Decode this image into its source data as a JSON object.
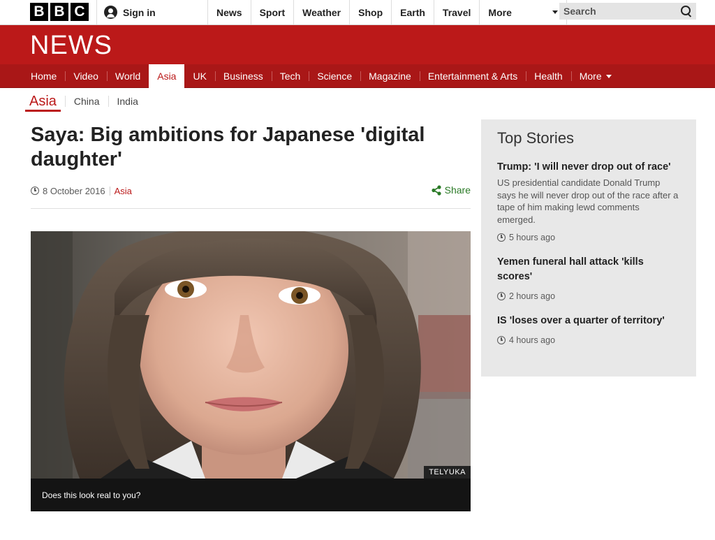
{
  "masthead": {
    "logo_letters": [
      "B",
      "B",
      "C"
    ],
    "signin_label": "Sign in",
    "nav": [
      "News",
      "Sport",
      "Weather",
      "Shop",
      "Earth",
      "Travel"
    ],
    "more_label": "More",
    "search_placeholder": "Search"
  },
  "banner": {
    "title": "NEWS"
  },
  "section_nav": {
    "items": [
      "Home",
      "Video",
      "World",
      "Asia",
      "UK",
      "Business",
      "Tech",
      "Science",
      "Magazine",
      "Entertainment & Arts",
      "Health"
    ],
    "active": "Asia",
    "more_label": "More"
  },
  "sub_nav": {
    "active": "Asia",
    "items": [
      "China",
      "India"
    ]
  },
  "article": {
    "headline": "Saya: Big ambitions for Japanese 'digital daughter'",
    "date": "8 October 2016",
    "section": "Asia",
    "share_label": "Share",
    "image_credit": "TELYUKA",
    "image_caption": "Does this look real to you?"
  },
  "top_stories": {
    "heading": "Top Stories",
    "stories": [
      {
        "title": "Trump: 'I will never drop out of race'",
        "summary": "US presidential candidate Donald Trump says he will never drop out of the race after a tape of him making lewd comments emerged.",
        "time": "5 hours ago"
      },
      {
        "title": "Yemen funeral hall attack 'kills scores'",
        "summary": "",
        "time": "2 hours ago"
      },
      {
        "title": "IS 'loses over a quarter of territory'",
        "summary": "",
        "time": "4 hours ago"
      }
    ]
  },
  "colors": {
    "brand_red": "#bb1919",
    "nav_red": "#a91717",
    "share_green": "#2a7a26"
  }
}
